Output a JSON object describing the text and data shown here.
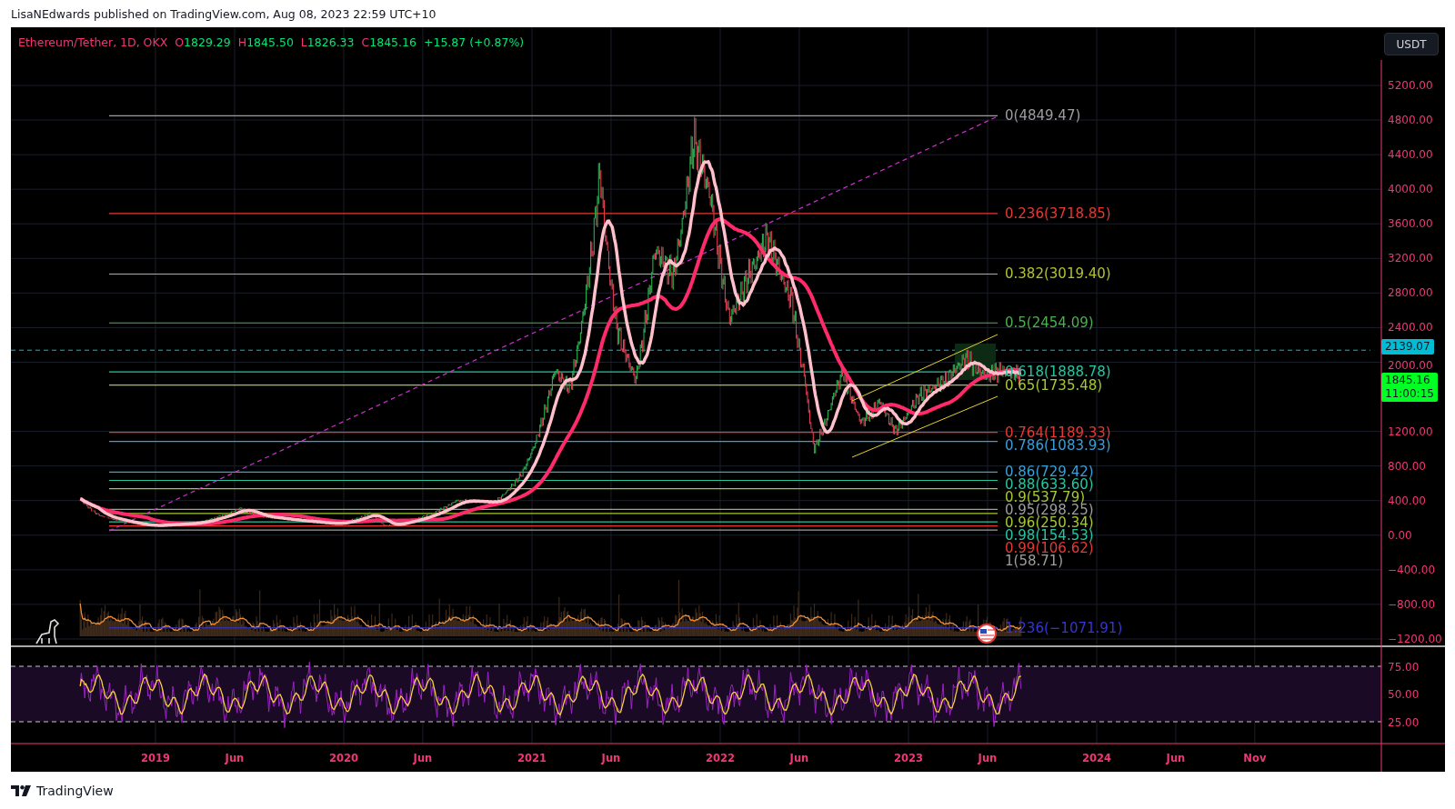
{
  "header": {
    "text": "LisaNEdwards published on TradingView.com, Aug 08, 2023 22:59 UTC+10"
  },
  "legend": {
    "symbol": "Ethereum/Tether, 1D, OKX",
    "ohlc": [
      {
        "letter": "O",
        "value": "1829.29"
      },
      {
        "letter": "H",
        "value": "1845.50"
      },
      {
        "letter": "L",
        "value": "1826.33"
      },
      {
        "letter": "C",
        "value": "1845.16"
      }
    ],
    "change": "+15.87 (+0.87%)"
  },
  "currency_button": "USDT",
  "price_axis": [
    "5200.00",
    "4800.00",
    "4400.00",
    "4000.00",
    "3600.00",
    "3200.00",
    "2800.00",
    "2400.00",
    "2000.00",
    "1200.00",
    "800.00",
    "400.00",
    "0.00",
    "−400.00",
    "−800.00",
    "−1200.00"
  ],
  "price_tags": [
    {
      "kind": "line",
      "text": "2139.07",
      "color": "#00bcd4"
    },
    {
      "kind": "last",
      "text": "1845.16",
      "countdown": "11:00:15",
      "color": "#00ff22"
    }
  ],
  "fib_levels": [
    {
      "label": "0(4849.47)",
      "color": "#9e9e9e"
    },
    {
      "label": "0.236(3718.85)",
      "color": "#e53935"
    },
    {
      "label": "0.382(3019.40)",
      "color": "#b2c232"
    },
    {
      "label": "0.5(2454.09)",
      "color": "#4caf50"
    },
    {
      "label": "0.618(1888.78)",
      "color": "#26c6a0"
    },
    {
      "label": "0.65(1735.48)",
      "color": "#a6c832"
    },
    {
      "label": "0.764(1189.33)",
      "color": "#e53935"
    },
    {
      "label": "0.786(1083.93)",
      "color": "#3a9fd8"
    },
    {
      "label": "0.86(729.42)",
      "color": "#3a9fd8"
    },
    {
      "label": "0.88(633.60)",
      "color": "#26c6a0"
    },
    {
      "label": "0.9(537.79)",
      "color": "#a6c832"
    },
    {
      "label": "0.95(298.25)",
      "color": "#9e9e9e"
    },
    {
      "label": "0.96(250.34)",
      "color": "#a6c832"
    },
    {
      "label": "0.98(154.53)",
      "color": "#26c6a0"
    },
    {
      "label": "0.99(106.62)",
      "color": "#e53935"
    },
    {
      "label": "1(58.71)",
      "color": "#9e9e9e"
    },
    {
      "label": "1.236(−1071.91)",
      "color": "#3535d6"
    }
  ],
  "rsi_axis": [
    "75.00",
    "50.00",
    "25.00"
  ],
  "time_axis": [
    "2019",
    "Jun",
    "2020",
    "Jun",
    "2021",
    "Jun",
    "2022",
    "Jun",
    "2023",
    "Jun",
    "2024",
    "Jun",
    "Nov"
  ],
  "footer": {
    "brand": "TradingView"
  }
}
